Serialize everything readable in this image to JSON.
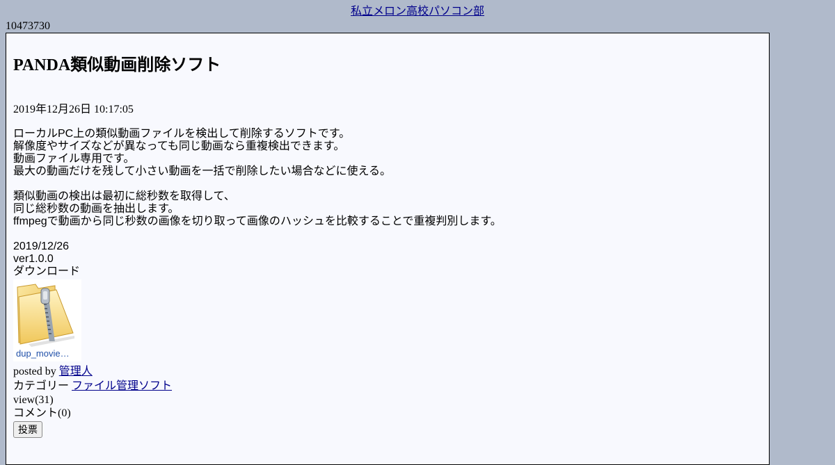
{
  "site": {
    "title": "私立メロン高校パソコン部",
    "counter": "10473730"
  },
  "post": {
    "title": "PANDA類似動画削除ソフト",
    "date": "2019年12月26日 10:17:05",
    "body_lines": [
      "ローカルPC上の類似動画ファイルを検出して削除するソフトです。",
      "解像度やサイズなどが異なっても同じ動画なら重複検出できます。",
      "動画ファイル専用です。",
      "最大の動画だけを残して小さい動画を一括で削除したい場合などに使える。",
      "",
      "類似動画の検出は最初に総秒数を取得して、",
      "同じ総秒数の動画を抽出します。",
      "ffmpegで動画から同じ秒数の画像を切り取って画像のハッシュを比較することで重複判別します。",
      "",
      "2019/12/26",
      "ver1.0.0",
      "ダウンロード"
    ],
    "attachment": {
      "name": "dup_movie…",
      "icon": "zip-folder-icon"
    },
    "posted_by_label": "posted by",
    "author": "管理人",
    "category_label": "カテゴリー",
    "category": "ファイル管理ソフト",
    "views": "view(31)",
    "comments": "コメント(0)",
    "vote_label": "投票"
  },
  "colors": {
    "page_background": "#b0bacb",
    "post_background": "#f8f9fe",
    "link": "#00008b",
    "folder_yellow": "#f5d76e"
  }
}
